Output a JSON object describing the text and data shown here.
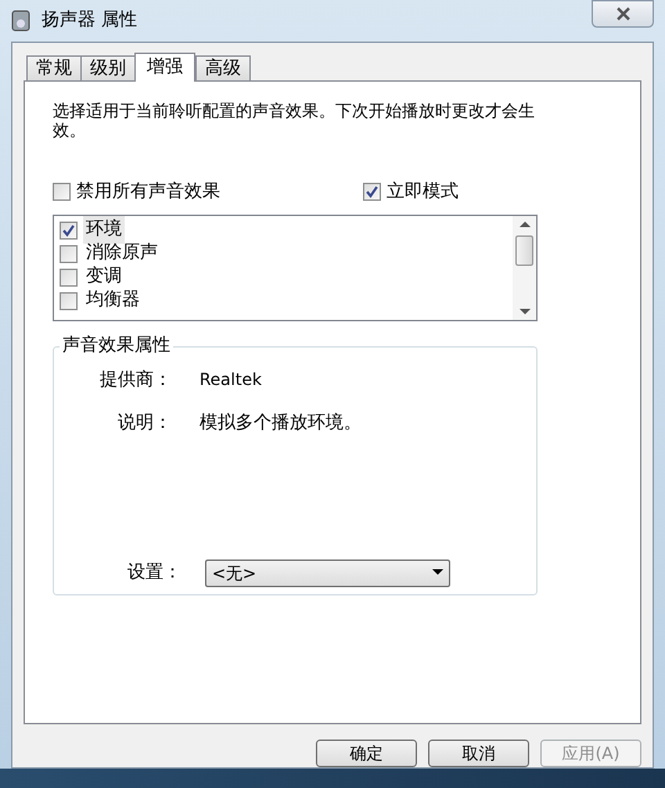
{
  "window": {
    "title": "扬声器 属性"
  },
  "tabs": [
    {
      "label": "常规",
      "selected": false
    },
    {
      "label": "级别",
      "selected": false
    },
    {
      "label": "增强",
      "selected": true
    },
    {
      "label": "高级",
      "selected": false
    }
  ],
  "description": "选择适用于当前聆听配置的声音效果。下次开始播放时更改才会生效。",
  "options": [
    {
      "label": "禁用所有声音效果",
      "checked": false
    },
    {
      "label": "立即模式",
      "checked": true
    }
  ],
  "effects": [
    {
      "label": "环境",
      "checked": true,
      "selected": true
    },
    {
      "label": "消除原声",
      "checked": false,
      "selected": false
    },
    {
      "label": "变调",
      "checked": false,
      "selected": false
    },
    {
      "label": "均衡器",
      "checked": false,
      "selected": false
    }
  ],
  "properties": {
    "title": "声音效果属性",
    "provider_label": "提供商：",
    "provider": "Realtek",
    "description_label": "说明：",
    "description": "模拟多个播放环境。",
    "setting_label": "设置：",
    "setting": "<无>"
  },
  "buttons": [
    {
      "label": "确定",
      "disabled": false
    },
    {
      "label": "取消",
      "disabled": false
    },
    {
      "label": "应用(A)",
      "disabled": true
    }
  ]
}
